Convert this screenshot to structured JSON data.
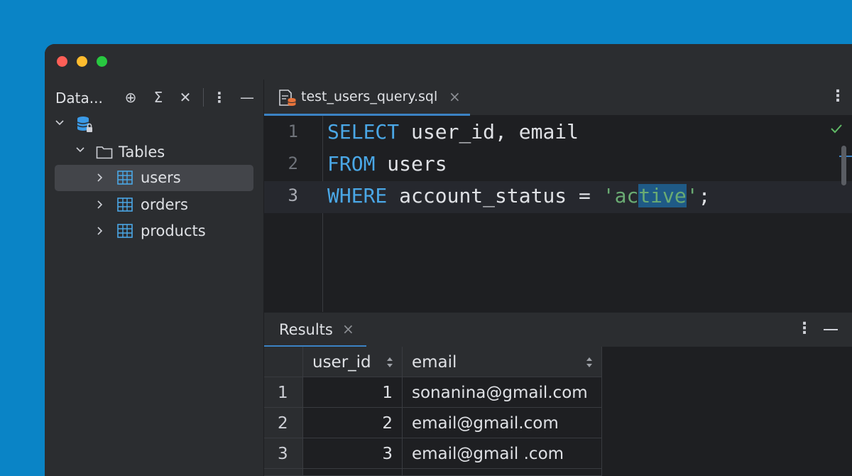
{
  "sidebar": {
    "title": "Data...",
    "tools": {
      "locate": "⊕",
      "sigma": "Σ",
      "close": "✕",
      "more": "⋮",
      "minimize": "—"
    },
    "tree": {
      "tables_label": "Tables",
      "items": [
        {
          "label": "users"
        },
        {
          "label": "orders"
        },
        {
          "label": "products"
        }
      ]
    }
  },
  "editor": {
    "tab_label": "test_users_query.sql",
    "tab_close": "×",
    "more": "⋮",
    "lines": [
      {
        "number": "1",
        "keyword": "SELECT",
        "rest": " user_id, email"
      },
      {
        "number": "2",
        "keyword": "FROM",
        "rest": " users"
      },
      {
        "number": "3",
        "keyword": "WHERE",
        "rest": " account_status = ",
        "string_pre": "'ac",
        "string_hl": "tive",
        "string_post": "'",
        "tail": ";"
      }
    ]
  },
  "results": {
    "tab_label": "Results",
    "tab_close": "×",
    "more": "⋮",
    "columns": [
      "user_id",
      "email"
    ],
    "rows": [
      {
        "n": "1",
        "user_id": "1",
        "email": "sonanina@gmail.com"
      },
      {
        "n": "2",
        "user_id": "2",
        "email": "email@gmail.com"
      },
      {
        "n": "3",
        "user_id": "3",
        "email": "email@gmail .com"
      }
    ]
  },
  "colors": {
    "accent": "#3b82c4",
    "keyword": "#4aa7e6",
    "string": "#6aab73",
    "selection": "#1f5a86"
  }
}
